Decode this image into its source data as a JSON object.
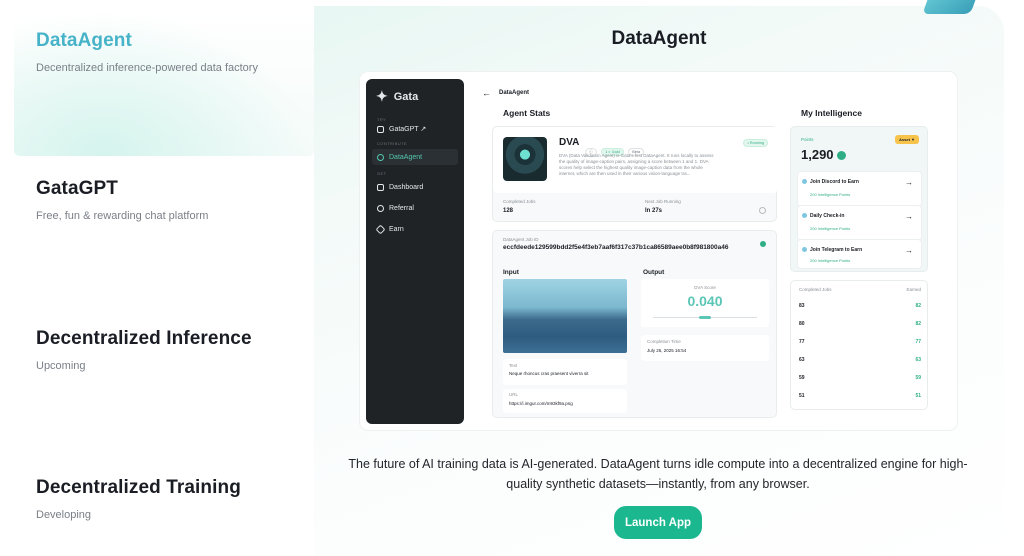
{
  "nav": {
    "items": [
      {
        "title": "DataAgent",
        "subtitle": "Decentralized inference-powered data factory"
      },
      {
        "title": "GataGPT",
        "subtitle": "Free, fun & rewarding chat platform"
      },
      {
        "title": "Decentralized Inference",
        "subtitle": "Upcoming"
      },
      {
        "title": "Decentralized Training",
        "subtitle": "Developing"
      }
    ]
  },
  "panel": {
    "title": "DataAgent",
    "description": "The future of AI training data is AI-generated. DataAgent turns idle compute into a decentralized engine for high-quality synthetic datasets—instantly, from any browser.",
    "launch_label": "Launch App"
  },
  "app": {
    "brand": "Gata",
    "sidebar": {
      "sec1": "TRY",
      "sec2": "CONTRIBUTE",
      "sec3": "GET",
      "items": [
        "GataGPT ↗",
        "DataAgent",
        "Dashboard",
        "Referral",
        "Earn"
      ]
    },
    "breadcrumb": "DataAgent",
    "agent_stats_title": "Agent Stats",
    "agent": {
      "name": "DVA",
      "status": "• Running",
      "desc": "DVA (Data Validation Agent) is Gata's first DataAgent. It runs locally to assess the quality of image-caption pairs, assigning a score between 1 and 1. DVA scores help select the highest quality image-caption data from the whole internet, which are then used in their various vision-language tra...",
      "completed_label": "Completed Jobs",
      "completed_value": "128",
      "next_label": "Next Job Running",
      "next_value": "In 27s"
    },
    "job": {
      "id_label": "DataAgent Job ID",
      "id_value": "eccfdeede129599bdd2f5e4f3eb7aaf6f317c37b1ca86589aee0b8f981800a46",
      "input_label": "Input",
      "output_label": "Output",
      "text_label": "Text",
      "text_value": "Neque rhoncus cras praesent viverra sit",
      "url_label": "URL",
      "url_value": "https://i.imgur.com/m93kf9a.png",
      "score_label": "DVA Score",
      "score_value": "0.040",
      "ctime_label": "Completion Time",
      "ctime_value": "July 25, 2025 16:54"
    },
    "intel": {
      "title": "My Intelligence",
      "points_label": "Points",
      "points_value": "1,290",
      "asset": "Asset ▼",
      "tasks": [
        {
          "title": "Join Discord to Earn",
          "reward": "200 Intelligence Points"
        },
        {
          "title": "Daily Check-in",
          "reward": "200 Intelligence Points"
        },
        {
          "title": "Join Telegram to Earn",
          "reward": "200 Intelligence Points"
        }
      ],
      "list_header_left": "Completed Jobs",
      "list_header_right": "Earned",
      "rows": [
        {
          "n": "83",
          "p": "82"
        },
        {
          "n": "80",
          "p": "82"
        },
        {
          "n": "77",
          "p": "77"
        },
        {
          "n": "63",
          "p": "63"
        },
        {
          "n": "59",
          "p": "59"
        },
        {
          "n": "51",
          "p": "51"
        }
      ]
    }
  }
}
